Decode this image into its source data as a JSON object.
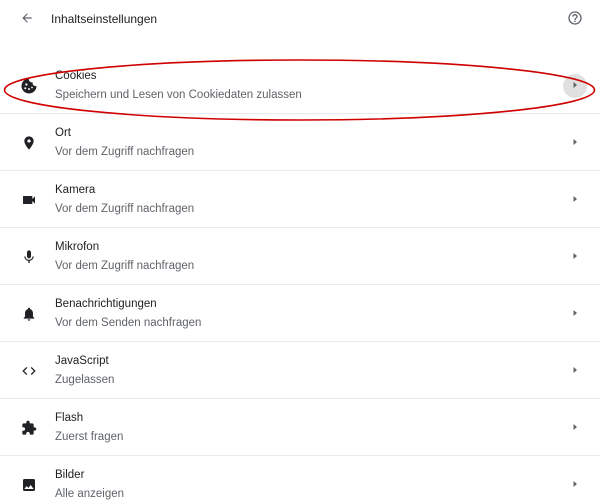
{
  "header": {
    "title": "Inhaltseinstellungen",
    "back_icon": "arrow-left-icon",
    "help_icon": "help-circle-icon"
  },
  "colors": {
    "icon": "#202124",
    "chevron": "#5f6368",
    "annotation": "#d00000",
    "hover": "#e0e0e0"
  },
  "settings": [
    {
      "label": "Cookies",
      "sublabel": "Speichern und Lesen von Cookiedaten zulassen",
      "icon": "cookie-icon"
    },
    {
      "label": "Ort",
      "sublabel": "Vor dem Zugriff nachfragen",
      "icon": "location-pin-icon"
    },
    {
      "label": "Kamera",
      "sublabel": "Vor dem Zugriff nachfragen",
      "icon": "camera-icon"
    },
    {
      "label": "Mikrofon",
      "sublabel": "Vor dem Zugriff nachfragen",
      "icon": "microphone-icon"
    },
    {
      "label": "Benachrichtigungen",
      "sublabel": "Vor dem Senden nachfragen",
      "icon": "bell-icon"
    },
    {
      "label": "JavaScript",
      "sublabel": "Zugelassen",
      "icon": "code-icon"
    },
    {
      "label": "Flash",
      "sublabel": "Zuerst fragen",
      "icon": "puzzle-icon"
    },
    {
      "label": "Bilder",
      "sublabel": "Alle anzeigen",
      "icon": "image-icon"
    }
  ]
}
